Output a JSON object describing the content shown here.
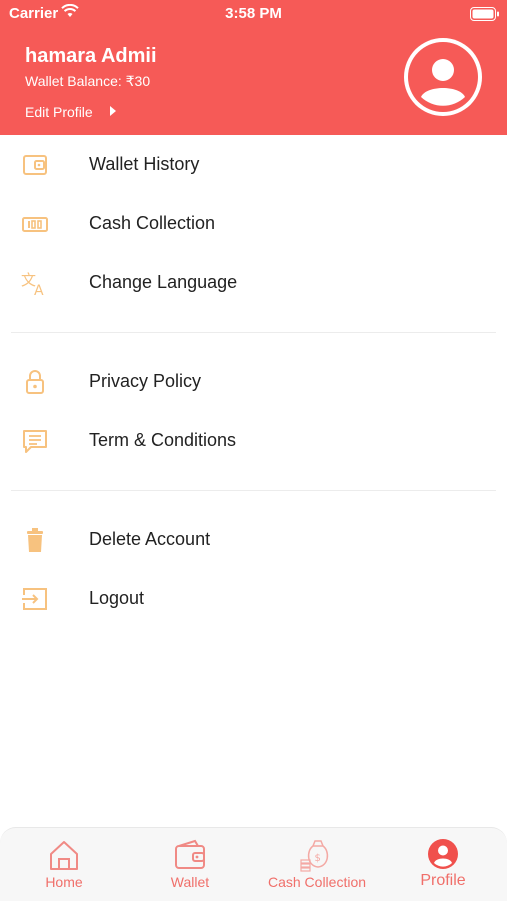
{
  "status_bar": {
    "carrier": "Carrier",
    "time": "3:58 PM"
  },
  "header": {
    "user_name": "hamara Admii",
    "wallet_balance": "Wallet Balance: ₹30",
    "edit_profile": "Edit Profile"
  },
  "menu": {
    "items": [
      {
        "label": "Wallet History",
        "icon": "wallet-icon"
      },
      {
        "label": "Cash Collection",
        "icon": "cash-icon"
      },
      {
        "label": "Change Language",
        "icon": "translate-icon"
      },
      {
        "label": "Privacy Policy",
        "icon": "lock-icon"
      },
      {
        "label": "Term & Conditions",
        "icon": "document-icon"
      },
      {
        "label": "Delete Account",
        "icon": "trash-icon"
      },
      {
        "label": "Logout",
        "icon": "logout-icon"
      }
    ]
  },
  "tabbar": {
    "items": [
      {
        "label": "Home",
        "icon": "home-icon",
        "active": false
      },
      {
        "label": "Wallet",
        "icon": "wallet-icon",
        "active": false
      },
      {
        "label": "Cash Collection",
        "icon": "money-bag-icon",
        "active": false
      },
      {
        "label": "Profile",
        "icon": "profile-icon",
        "active": true
      }
    ]
  },
  "colors": {
    "brand": "#f65a57",
    "icon_orange": "#f7c27f",
    "text": "#222222",
    "tab_text": "#f06f6a"
  }
}
